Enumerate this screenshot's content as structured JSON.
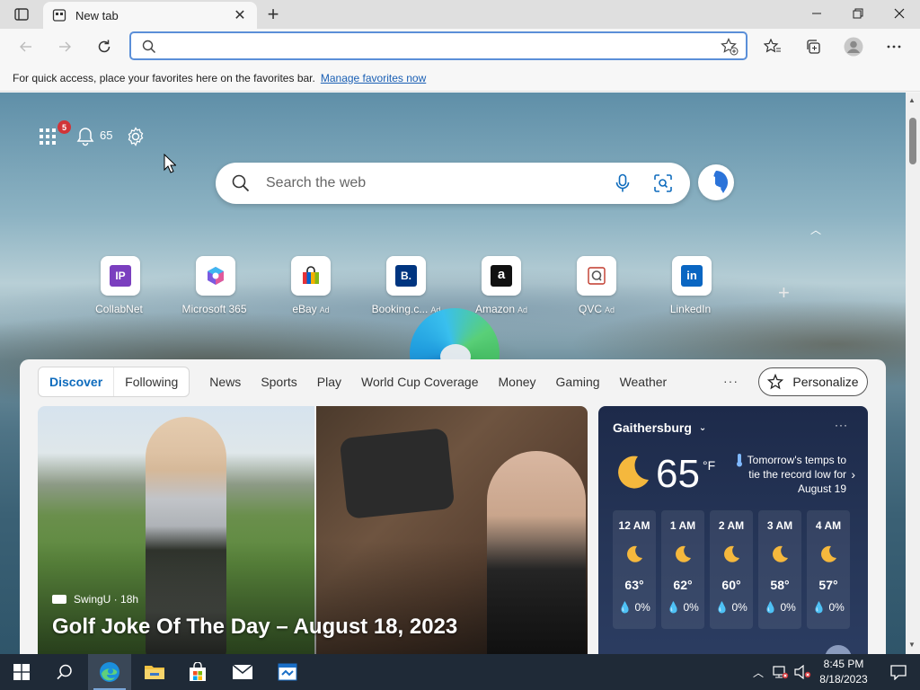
{
  "browser": {
    "tab_title": "New tab",
    "address_placeholder": "",
    "favbar_text": "For quick access, place your favorites here on the favorites bar.",
    "favbar_link": "Manage favorites now"
  },
  "ntp": {
    "notification_count": "5",
    "temp_mini": "65",
    "search_placeholder": "Search the web",
    "tiles": [
      {
        "name": "CollabNet",
        "ad": ""
      },
      {
        "name": "Microsoft 365",
        "ad": ""
      },
      {
        "name": "eBay",
        "ad": "Ad"
      },
      {
        "name": "Booking.c...",
        "ad": "Ad"
      },
      {
        "name": "Amazon",
        "ad": "Ad"
      },
      {
        "name": "QVC",
        "ad": "Ad"
      },
      {
        "name": "LinkedIn",
        "ad": ""
      }
    ],
    "tile_glyphs": {
      "collabnet": "IP",
      "booking": "B.",
      "amazon": "a",
      "linkedin": "in"
    }
  },
  "feed": {
    "tabs": [
      "Discover",
      "Following",
      "News",
      "Sports",
      "Play",
      "World Cup Coverage",
      "Money",
      "Gaming",
      "Weather"
    ],
    "personalize": "Personalize",
    "article": {
      "source": "SwingU · 18h",
      "headline": "Golf Joke Of The Day – August 18, 2023"
    }
  },
  "weather": {
    "location": "Gaithersburg",
    "temp": "65",
    "unit": "°F",
    "note": "Tomorrow's temps to tie the record low for August 19",
    "hours": [
      {
        "h": "12 AM",
        "t": "63°",
        "p": "0%"
      },
      {
        "h": "1 AM",
        "t": "62°",
        "p": "0%"
      },
      {
        "h": "2 AM",
        "t": "60°",
        "p": "0%"
      },
      {
        "h": "3 AM",
        "t": "58°",
        "p": "0%"
      },
      {
        "h": "4 AM",
        "t": "57°",
        "p": "0%"
      }
    ]
  },
  "taskbar": {
    "time": "8:45 PM",
    "date": "8/18/2023"
  },
  "colors": {
    "accent": "#0f6cbd",
    "badge": "#d13438",
    "taskbar": "#1f2a37",
    "weather_bg": "#1d2a4a"
  }
}
